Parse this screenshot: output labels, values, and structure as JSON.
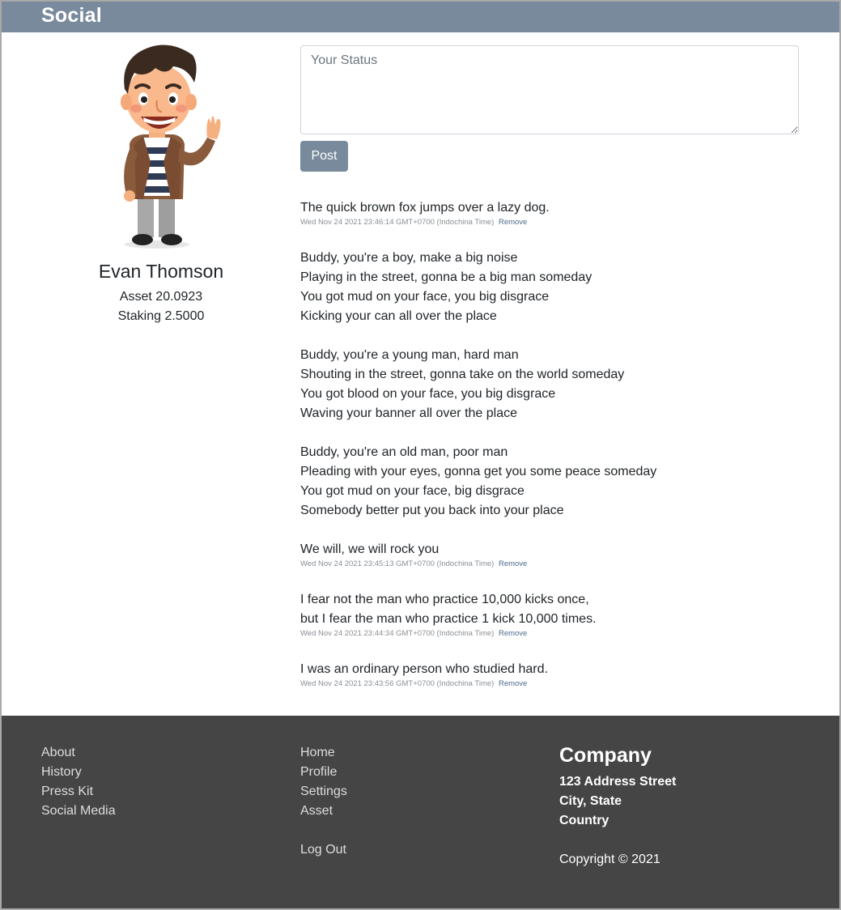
{
  "navbar": {
    "brand": "Social"
  },
  "profile": {
    "name": "Evan Thomson",
    "asset": "Asset 20.0923",
    "staking": "Staking 2.5000"
  },
  "composer": {
    "placeholder": "Your Status",
    "post_label": "Post"
  },
  "posts": [
    {
      "text": "The quick brown fox jumps over a lazy dog.",
      "timestamp": "Wed Nov 24 2021 23:46:14 GMT+0700 (Indochina Time)",
      "remove_label": "Remove"
    },
    {
      "text": "Buddy, you're a boy, make a big noise\nPlaying in the street, gonna be a big man someday\nYou got mud on your face, you big disgrace\nKicking your can all over the place\n\nBuddy, you're a young man, hard man\nShouting in the street, gonna take on the world someday\nYou got blood on your face, you big disgrace\nWaving your banner all over the place\n\nBuddy, you're an old man, poor man\nPleading with your eyes, gonna get you some peace someday\nYou got mud on your face, big disgrace\nSomebody better put you back into your place\n\nWe will, we will rock you",
      "timestamp": "Wed Nov 24 2021 23:45:13 GMT+0700 (Indochina Time)",
      "remove_label": "Remove"
    },
    {
      "text": "I fear not the man who practice 10,000 kicks once,\nbut I fear the man who practice 1 kick 10,000 times.",
      "timestamp": "Wed Nov 24 2021 23:44:34 GMT+0700 (Indochina Time)",
      "remove_label": "Remove"
    },
    {
      "text": "I was an ordinary person who studied hard.",
      "timestamp": "Wed Nov 24 2021 23:43:56 GMT+0700 (Indochina Time)",
      "remove_label": "Remove"
    }
  ],
  "footer": {
    "col1": [
      "About",
      "History",
      "Press Kit",
      "Social Media"
    ],
    "col2": [
      "Home",
      "Profile",
      "Settings",
      "Asset"
    ],
    "logout": "Log Out",
    "company": {
      "title": "Company",
      "address1": "123 Address Street",
      "address2": "City, State",
      "country": "Country",
      "copyright": "Copyright © 2021"
    }
  },
  "colors": {
    "navbar": "#788a9c",
    "footer": "#454545",
    "button": "#788a9c"
  }
}
